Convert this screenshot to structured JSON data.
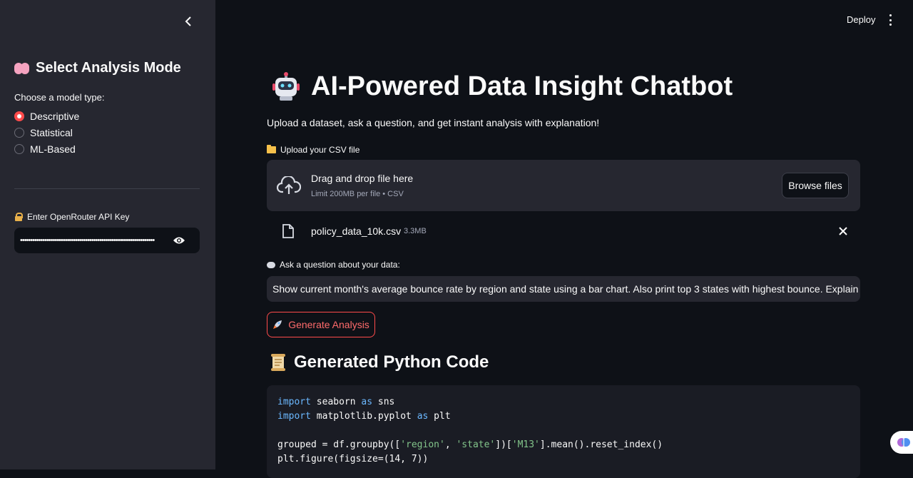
{
  "sidebar": {
    "title": "Select Analysis Mode",
    "radio_label": "Choose a model type:",
    "options": [
      "Descriptive",
      "Statistical",
      "ML-Based"
    ],
    "selected": "Descriptive",
    "api_label": "Enter OpenRouter API Key",
    "api_value": "••••••••••••••••••••••••••••••••••••••••••••••••••••••••••••••••••"
  },
  "topbar": {
    "deploy_label": "Deploy"
  },
  "main": {
    "title": "AI-Powered Data Insight Chatbot",
    "subtitle": "Upload a dataset, ask a question, and get instant analysis with explanation!",
    "upload_label": "Upload your CSV file",
    "dropzone_main": "Drag and drop file here",
    "dropzone_sub": "Limit 200MB per file • CSV",
    "browse_label": "Browse files",
    "file_name": "policy_data_10k.csv",
    "file_size": "3.3MB",
    "ask_label": "Ask a question about your data:",
    "question": "Show current month's average bounce rate by region and state using a bar chart. Also print top 3 states with highest bounce. Explain what this means.",
    "generate_label": "Generate Analysis",
    "code_section_title": "Generated Python Code"
  },
  "code": {
    "line1_kw": "import",
    "line1_a": " seaborn ",
    "line1_kw2": "as",
    "line1_b": " sns",
    "line2_kw": "import",
    "line2_a": " matplotlib.pyplot ",
    "line2_kw2": "as",
    "line2_b": " plt",
    "line4_a": "grouped = df.groupby([",
    "line4_s1": "'region'",
    "line4_b": ", ",
    "line4_s2": "'state'",
    "line4_c": "])[",
    "line4_s3": "'M13'",
    "line4_d": "].mean().reset_index()",
    "line5": "plt.figure(figsize=(14, 7))"
  },
  "colors": {
    "accent": "#ff4b4b",
    "background": "#0e1117",
    "sidebar": "#262730"
  }
}
